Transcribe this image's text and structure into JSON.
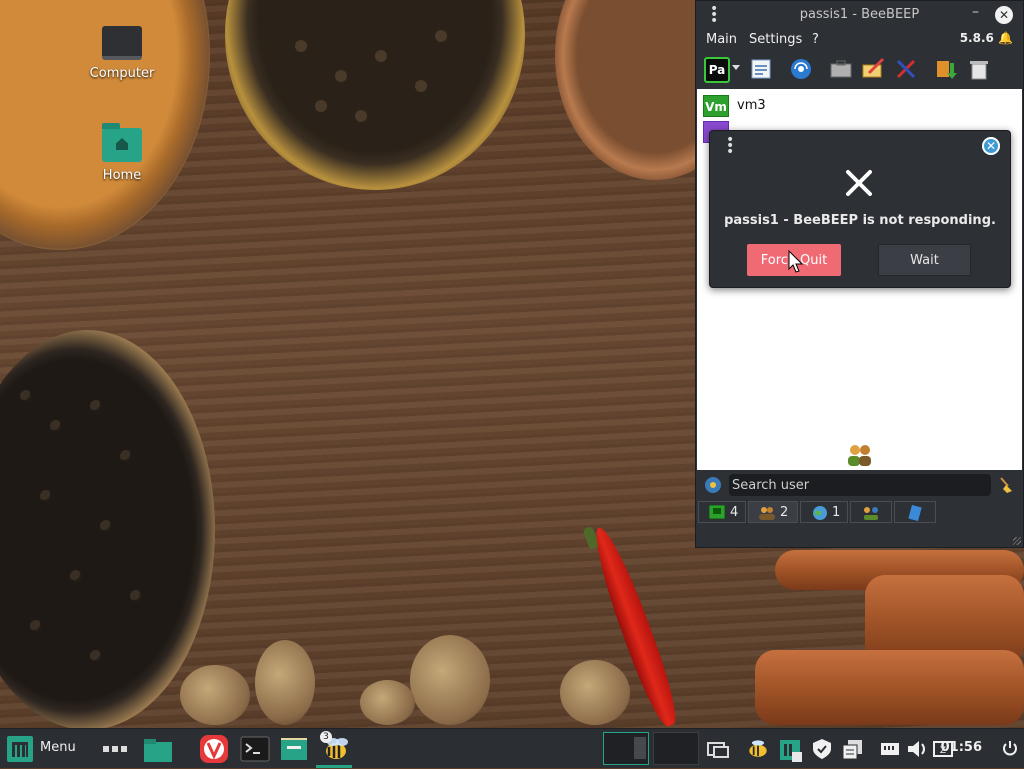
{
  "desktop": {
    "icons": [
      {
        "label": "Computer"
      },
      {
        "label": "Home"
      }
    ]
  },
  "beebeep": {
    "title": "passis1 - BeeBEEP",
    "menu": [
      "Main",
      "Settings",
      "?"
    ],
    "version": "5.8.6",
    "users": [
      {
        "badge": "Vm",
        "name": "vm3"
      }
    ],
    "search_placeholder": "Search user",
    "tabs": [
      {
        "count": "4"
      },
      {
        "count": "2"
      },
      {
        "count": "1"
      },
      {
        "count": ""
      },
      {
        "count": ""
      }
    ]
  },
  "dialog": {
    "message": "passis1 - BeeBEEP is not responding.",
    "force_quit_label": "Force Quit",
    "wait_label": "Wait"
  },
  "taskbar": {
    "menu_label": "Menu",
    "badge_count": "3",
    "clock": "01:56"
  },
  "colors": {
    "accent": "#27a487",
    "force_quit": "#f06a74",
    "dialog_close": "#3f9bd4",
    "window_bg": "#2d3035"
  }
}
